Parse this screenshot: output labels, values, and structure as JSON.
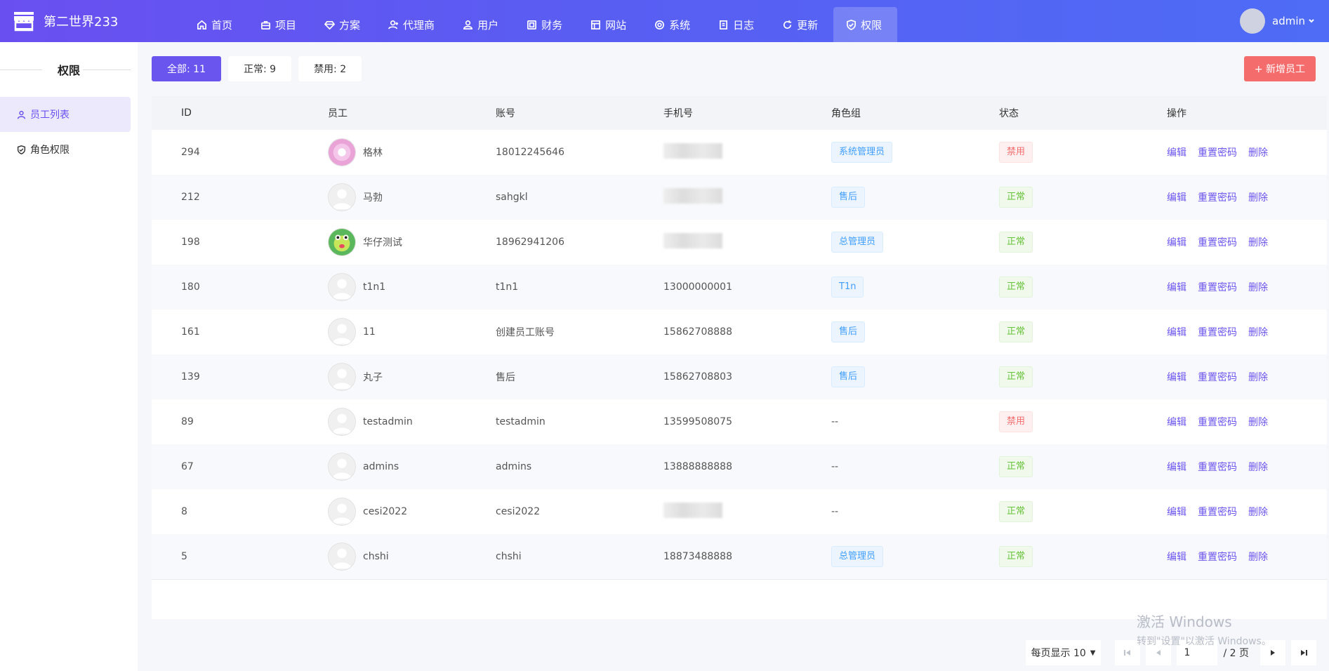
{
  "brand": {
    "title": "第二世界233"
  },
  "nav": [
    {
      "label": "首页",
      "icon": "home-icon"
    },
    {
      "label": "项目",
      "icon": "briefcase-icon"
    },
    {
      "label": "方案",
      "icon": "diamond-icon"
    },
    {
      "label": "代理商",
      "icon": "user-plus-icon"
    },
    {
      "label": "用户",
      "icon": "users-icon"
    },
    {
      "label": "财务",
      "icon": "finance-icon"
    },
    {
      "label": "网站",
      "icon": "layout-icon"
    },
    {
      "label": "系统",
      "icon": "gear-icon"
    },
    {
      "label": "日志",
      "icon": "log-icon"
    },
    {
      "label": "更新",
      "icon": "refresh-icon"
    },
    {
      "label": "权限",
      "icon": "shield-icon",
      "active": true
    }
  ],
  "user": {
    "name": "admin"
  },
  "sidebar": {
    "title": "权限",
    "items": [
      {
        "label": "员工列表",
        "icon": "user-icon",
        "active": true
      },
      {
        "label": "角色权限",
        "icon": "shield-icon"
      }
    ]
  },
  "filters": [
    {
      "label": "全部:  11",
      "active": true
    },
    {
      "label": "正常:  9"
    },
    {
      "label": "禁用:  2"
    }
  ],
  "add_button": "+ 新增员工",
  "table": {
    "headers": [
      "ID",
      "员工",
      "账号",
      "手机号",
      "角色组",
      "状态",
      "操作"
    ],
    "rows": [
      {
        "id": "294",
        "name": "格林",
        "account": "18012245646",
        "phone": "",
        "role": "系统管理员",
        "status": "禁用",
        "avatar": "donut"
      },
      {
        "id": "212",
        "name": "马勃",
        "account": "sahgkl",
        "phone": "",
        "role": "售后",
        "status": "正常",
        "avatar": "default"
      },
      {
        "id": "198",
        "name": "华仔测试",
        "account": "18962941206",
        "phone": "",
        "role": "总管理员",
        "status": "正常",
        "avatar": "frog"
      },
      {
        "id": "180",
        "name": "t1n1",
        "account": "t1n1",
        "phone": "13000000001",
        "role": "T1n",
        "status": "正常",
        "avatar": "default"
      },
      {
        "id": "161",
        "name": "11",
        "account": "创建员工账号",
        "phone": "15862708888",
        "role": "售后",
        "status": "正常",
        "avatar": "default"
      },
      {
        "id": "139",
        "name": "丸子",
        "account": "售后",
        "phone": "15862708803",
        "role": "售后",
        "status": "正常",
        "avatar": "default"
      },
      {
        "id": "89",
        "name": "testadmin",
        "account": "testadmin",
        "phone": "13599508075",
        "role": "--",
        "status": "禁用",
        "avatar": "default"
      },
      {
        "id": "67",
        "name": "admins",
        "account": "admins",
        "phone": "13888888888",
        "role": "--",
        "status": "正常",
        "avatar": "default"
      },
      {
        "id": "8",
        "name": "cesi2022",
        "account": "cesi2022",
        "phone": "",
        "role": "--",
        "status": "正常",
        "avatar": "default"
      },
      {
        "id": "5",
        "name": "chshi",
        "account": "chshi",
        "phone": "18873488888",
        "role": "总管理员",
        "status": "正常",
        "avatar": "default"
      }
    ],
    "ops": [
      "编辑",
      "重置密码",
      "删除"
    ]
  },
  "pagination": {
    "page_size_label": "每页显示 10",
    "current_page": "1",
    "total_label": "/ 2 页"
  },
  "watermark": {
    "line1": "激活 Windows",
    "line2": "转到\"设置\"以激活 Windows。"
  },
  "colors": {
    "primary": "#6a55ef",
    "danger": "#f56c6c",
    "success": "#67c23a",
    "info": "#409eff"
  }
}
